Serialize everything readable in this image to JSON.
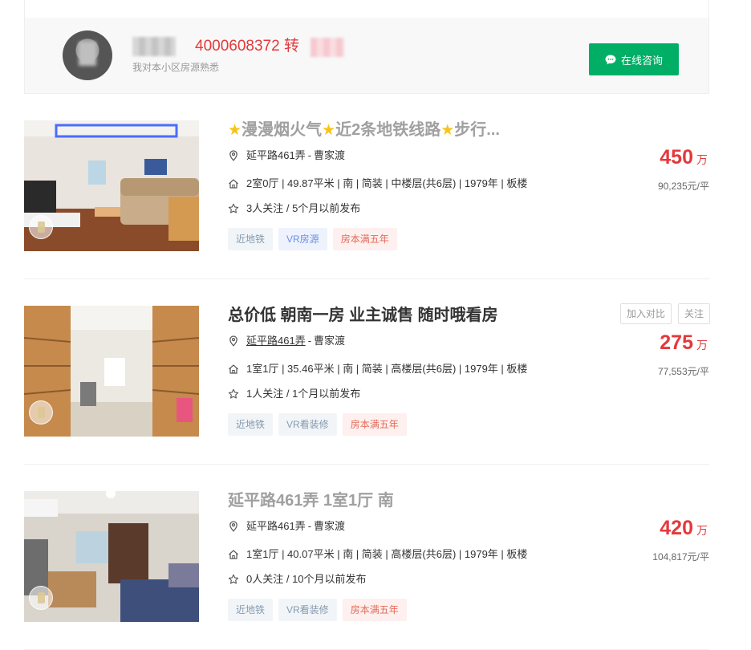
{
  "agent": {
    "phone": "4000608372 转",
    "description": "我对本小区房源熟悉",
    "consult_button": "在线咨询"
  },
  "listings": [
    {
      "title_parts": [
        "漫漫烟火气",
        "近2条地铁线路",
        "步行..."
      ],
      "position_name": "延平路461弄",
      "district": "曹家渡",
      "house_info": "2室0厅 | 49.87平米 | 南 | 简装 | 中楼层(共6层) | 1979年 | 板楼",
      "follow_info": "3人关注 / 5个月以前发布",
      "tags": [
        "近地铁",
        "VR房源",
        "房本满五年"
      ],
      "price": "450",
      "price_unit": "万",
      "unit_price": "90,235元/平"
    },
    {
      "title": "总价低 朝南一房 业主诚售 随时哦看房",
      "position_name": "延平路461弄",
      "district": "曹家渡",
      "house_info": "1室1厅 | 35.46平米 | 南 | 简装 | 高楼层(共6层) | 1979年 | 板楼",
      "follow_info": "1人关注 / 1个月以前发布",
      "tags": [
        "近地铁",
        "VR看装修",
        "房本满五年"
      ],
      "price": "275",
      "price_unit": "万",
      "unit_price": "77,553元/平",
      "compare_button": "加入对比",
      "follow_button": "关注"
    },
    {
      "title": "延平路461弄 1室1厅 南",
      "position_name": "延平路461弄",
      "district": "曹家渡",
      "house_info": "1室1厅 | 40.07平米 | 南 | 简装 | 高楼层(共6层) | 1979年 | 板楼",
      "follow_info": "0人关注 / 10个月以前发布",
      "tags": [
        "近地铁",
        "VR看装修",
        "房本满五年"
      ],
      "price": "420",
      "price_unit": "万",
      "unit_price": "104,817元/平"
    }
  ],
  "colors": {
    "price_red": "#e4393c",
    "consult_green": "#00ae66",
    "star_yellow": "#f7c41a"
  }
}
